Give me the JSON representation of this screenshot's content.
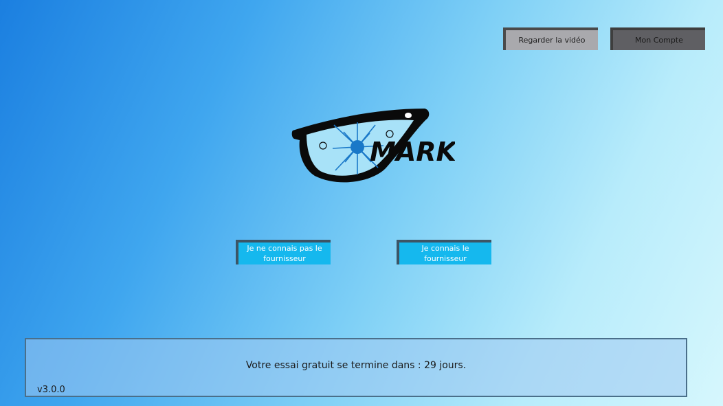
{
  "header": {
    "watch_video_label": "Regarder la vidéo",
    "account_label": "Mon Compte"
  },
  "logo": {
    "text": "MARK",
    "icon": "glasses-logo-icon",
    "accent_color": "#1978c8"
  },
  "choices": {
    "unknown_supplier_label": "Je ne connais pas le fournisseur",
    "known_supplier_label": "Je connais le fournisseur"
  },
  "trial": {
    "message": "Votre essai gratuit se termine dans : 29 jours."
  },
  "footer": {
    "version": "v3.0.0"
  }
}
